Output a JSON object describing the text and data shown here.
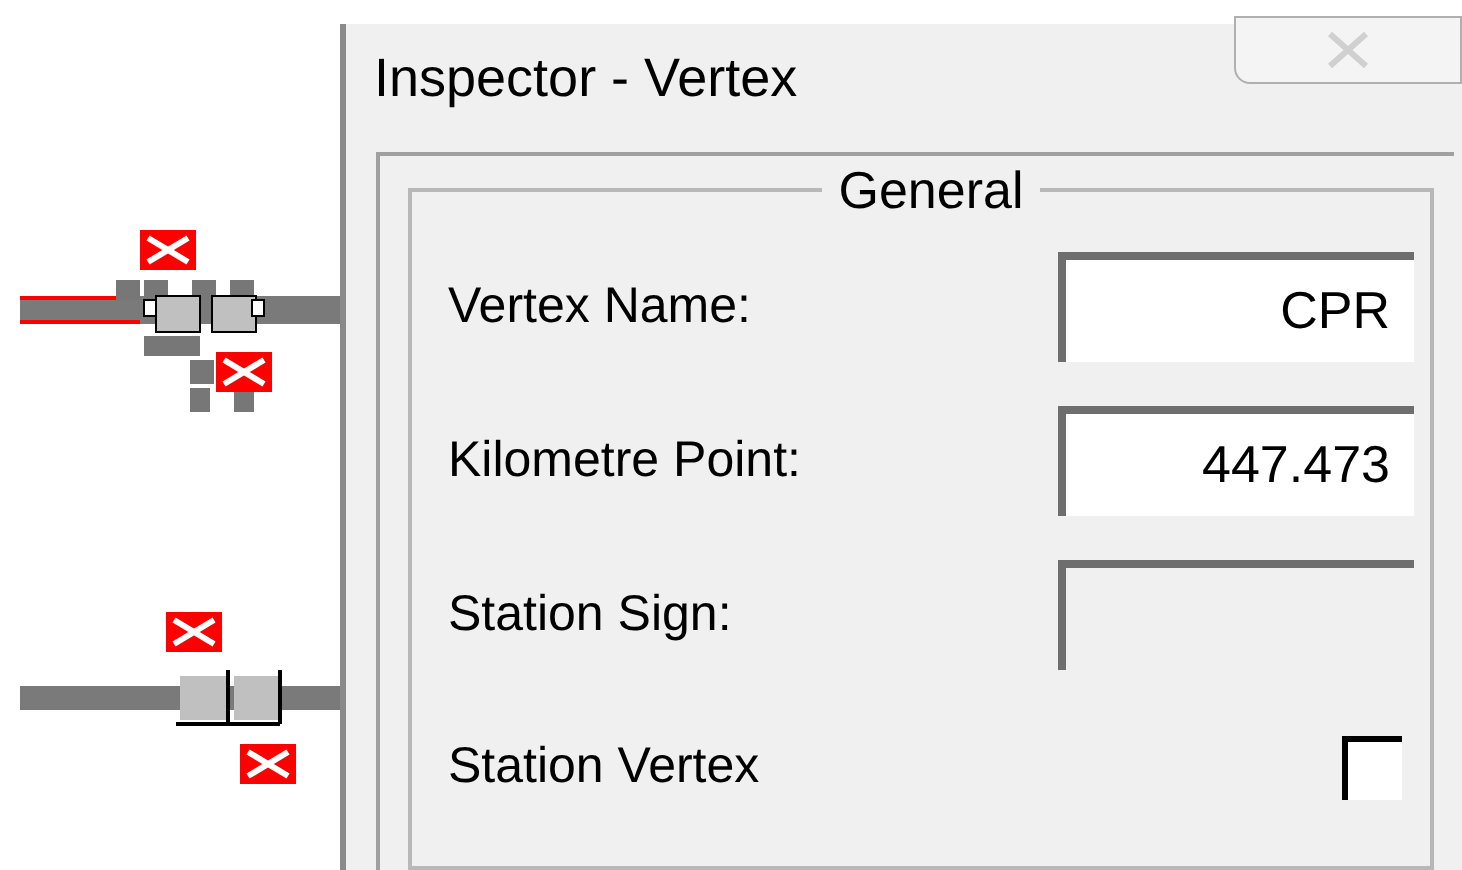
{
  "window": {
    "title": "Inspector - Vertex"
  },
  "group": {
    "title": "General"
  },
  "fields": [
    {
      "label": "Vertex Name:",
      "value": "CPR",
      "disabled": false
    },
    {
      "label": "Kilometre Point:",
      "value": "447.473",
      "disabled": false
    },
    {
      "label": "Station Sign:",
      "disabled": true
    }
  ],
  "checkbox": {
    "label": "Station Vertex",
    "checked": false
  }
}
